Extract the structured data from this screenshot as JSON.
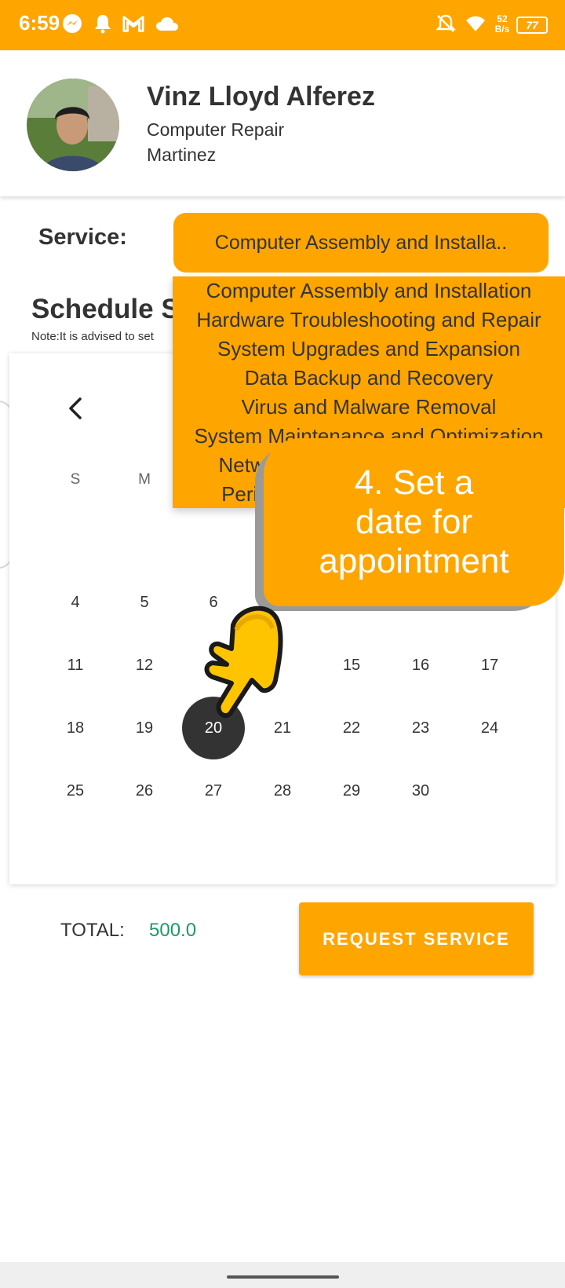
{
  "status_bar": {
    "time": "6:59",
    "net_speed_value": "52",
    "net_speed_unit": "B/s",
    "battery": "77",
    "icons": [
      "messenger-icon",
      "bell-icon",
      "gmail-icon",
      "cloud-icon",
      "bell-muted-icon",
      "wifi-icon",
      "battery-icon"
    ]
  },
  "profile": {
    "name": "Vinz Lloyd Alferez",
    "category": "Computer Repair",
    "location": "Martinez"
  },
  "service": {
    "label": "Service:",
    "selected": "Computer Assembly and Installa..",
    "options": [
      "Computer Assembly and Installation",
      "Hardware Troubleshooting and Repair",
      "System Upgrades and Expansion",
      "Data Backup and Recovery",
      "Virus and Malware Removal",
      "System Maintenance and Optimization",
      "Network Setup and Configuration",
      "Peripheral Installation and Setup"
    ]
  },
  "schedule": {
    "title": "Schedule S",
    "note": "Note:It is advised to set"
  },
  "calendar": {
    "weekdays": [
      "S",
      "M"
    ],
    "days": [
      "4",
      "5",
      "6",
      "11",
      "12",
      "15",
      "16",
      "17",
      "18",
      "19",
      "20",
      "21",
      "22",
      "23",
      "24",
      "25",
      "26",
      "27",
      "28",
      "29",
      "30"
    ],
    "selected_day": "20"
  },
  "tooltip": {
    "line1": "4. Set a",
    "line2": "date for",
    "line3": "appointment"
  },
  "footer": {
    "total_label": "TOTAL:",
    "total_value": "500.0",
    "request_button": "REQUEST SERVICE"
  },
  "colors": {
    "accent": "#FFA500",
    "total_value": "#1a9a66",
    "selected_day_bg": "#333333"
  }
}
